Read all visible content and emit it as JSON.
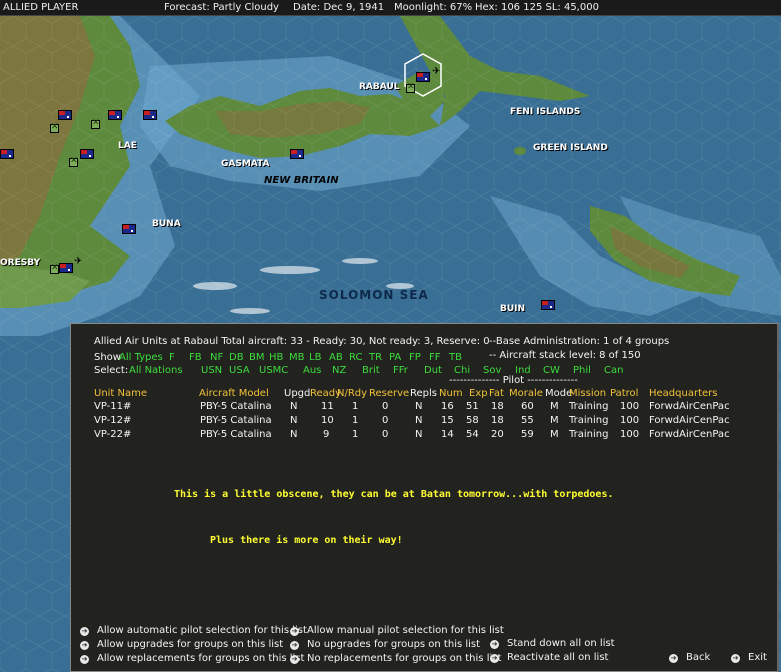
{
  "status_bar": {
    "player": "ALLIED PLAYER",
    "forecast": "Forecast: Partly Cloudy",
    "date": "Date: Dec 9, 1941",
    "moonlight": "Moonlight: 67%",
    "hex": "Hex: 106 125  SL: 45,000"
  },
  "map": {
    "labels": {
      "rabaul": "RABAUL",
      "feni": "FENI ISLANDS",
      "green": "GREEN ISLAND",
      "lae": "LAE",
      "gasmata": "GASMATA",
      "new_britain": "NEW BRITAIN",
      "buna": "BUNA",
      "oresby": "ORESBY",
      "solomon_sea": "SOLOMON SEA",
      "buin": "BUIN"
    },
    "colors": {
      "sea": "#3a6f95",
      "shallow": "#6fa9cf",
      "land": "#5d8a3c",
      "mountain": "#8b6d3f"
    }
  },
  "panel": {
    "summary": "Allied Air Units at Rabaul  Total aircraft: 33 - Ready: 30, Not ready: 3, Reserve: 0",
    "base_admin": "--Base Administration: 1 of 4 groups",
    "stack_level": "-- Aircraft stack level: 8 of 150",
    "show_label": "Show",
    "type_filters": [
      "All Types",
      "F",
      "FB",
      "NF",
      "DB",
      "BM",
      "HB",
      "MB",
      "LB",
      "AB",
      "RC",
      "TR",
      "PA",
      "FP",
      "FF",
      "TB"
    ],
    "select_label": "Select:",
    "nation_filters": [
      "All Nations",
      "USN",
      "USA",
      "USMC",
      "Aus",
      "NZ",
      "Brit",
      "FFr",
      "Dut",
      "Chi",
      "Sov",
      "Ind",
      "CW",
      "Phil",
      "Can"
    ],
    "pilot_group": "-------------- Pilot --------------",
    "columns": {
      "unit": "Unit Name",
      "model": "Aircraft Model",
      "upgd": "Upgd",
      "ready": "Ready",
      "nrdy": "N/Rdy",
      "reserve": "Reserve",
      "repls": "Repls",
      "num": "Num",
      "exp": "Exp",
      "fat": "Fat",
      "morale": "Morale",
      "mode": "Mode",
      "mission": "Mission",
      "patrol": "Patrol",
      "hq": "Headquarters"
    },
    "rows": [
      {
        "unit": "VP-11#",
        "model": "PBY-5 Catalina",
        "upgd": "N",
        "ready": "11",
        "nrdy": "1",
        "reserve": "0",
        "repls": "N",
        "num": "16",
        "exp": "51",
        "fat": "18",
        "morale": "60",
        "mode": "M",
        "mission": "Training",
        "patrol": "100",
        "hq": "ForwdAirCenPac"
      },
      {
        "unit": "VP-12#",
        "model": "PBY-5 Catalina",
        "upgd": "N",
        "ready": "10",
        "nrdy": "1",
        "reserve": "0",
        "repls": "N",
        "num": "15",
        "exp": "58",
        "fat": "18",
        "morale": "55",
        "mode": "M",
        "mission": "Training",
        "patrol": "100",
        "hq": "ForwdAirCenPac"
      },
      {
        "unit": "VP-22#",
        "model": "PBY-5 Catalina",
        "upgd": "N",
        "ready": "9",
        "nrdy": "1",
        "reserve": "0",
        "repls": "N",
        "num": "14",
        "exp": "54",
        "fat": "20",
        "morale": "59",
        "mode": "M",
        "mission": "Training",
        "patrol": "100",
        "hq": "ForwdAirCenPac"
      }
    ],
    "comment_1": "This is a little obscene, they can be at Batan tomorrow...with torpedoes.",
    "comment_2": "Plus there is more on their way!",
    "options": {
      "auto_pilot": "Allow automatic pilot selection for this list",
      "manual_pilot": "Allow manual pilot selection for this list",
      "allow_upgrades": "Allow upgrades for groups on this list",
      "no_upgrades": "No upgrades for groups on this list",
      "stand_down": "Stand down all on list",
      "allow_repl": "Allow replacements for groups on this list",
      "no_repl": "No replacements for groups on this list",
      "reactivate": "Reactivate all on list",
      "back": "Back",
      "exit": "Exit"
    }
  }
}
